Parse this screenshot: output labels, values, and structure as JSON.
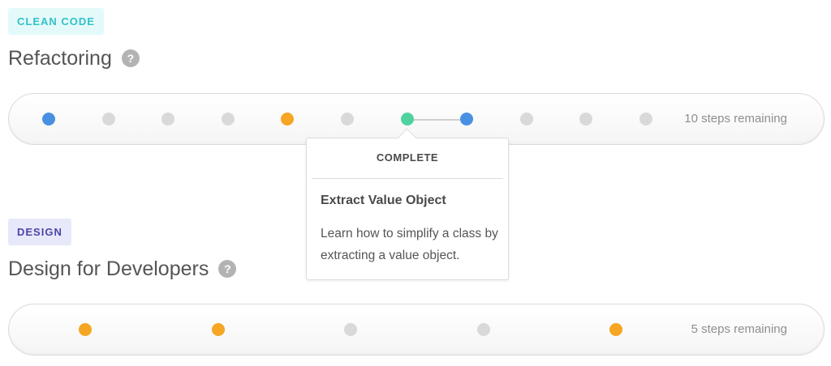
{
  "courses": [
    {
      "badge": "CLEAN CODE",
      "badge_color": "#32c1c8",
      "title": "Refactoring",
      "help": "?",
      "remaining": "10 steps remaining",
      "steps": [
        {
          "status": "blue"
        },
        {
          "status": "gray"
        },
        {
          "status": "gray"
        },
        {
          "status": "gray"
        },
        {
          "status": "orange"
        },
        {
          "status": "gray"
        },
        {
          "status": "green"
        },
        {
          "status": "blue"
        },
        {
          "status": "gray"
        },
        {
          "status": "gray"
        },
        {
          "status": "gray"
        }
      ]
    },
    {
      "badge": "DESIGN",
      "badge_color": "#4a45a8",
      "title": "Design for Developers",
      "help": "?",
      "remaining": "5 steps remaining",
      "steps": [
        {
          "status": "orange"
        },
        {
          "status": "orange"
        },
        {
          "status": "gray"
        },
        {
          "status": "gray"
        },
        {
          "status": "orange"
        }
      ]
    }
  ],
  "tooltip": {
    "status": "COMPLETE",
    "title": "Extract Value Object",
    "description": "Learn how to simplify a class by extracting a value object."
  },
  "colors": {
    "blue": "#4a90e2",
    "gray": "#d9d9d9",
    "orange": "#f5a623",
    "green": "#50d2a0"
  }
}
